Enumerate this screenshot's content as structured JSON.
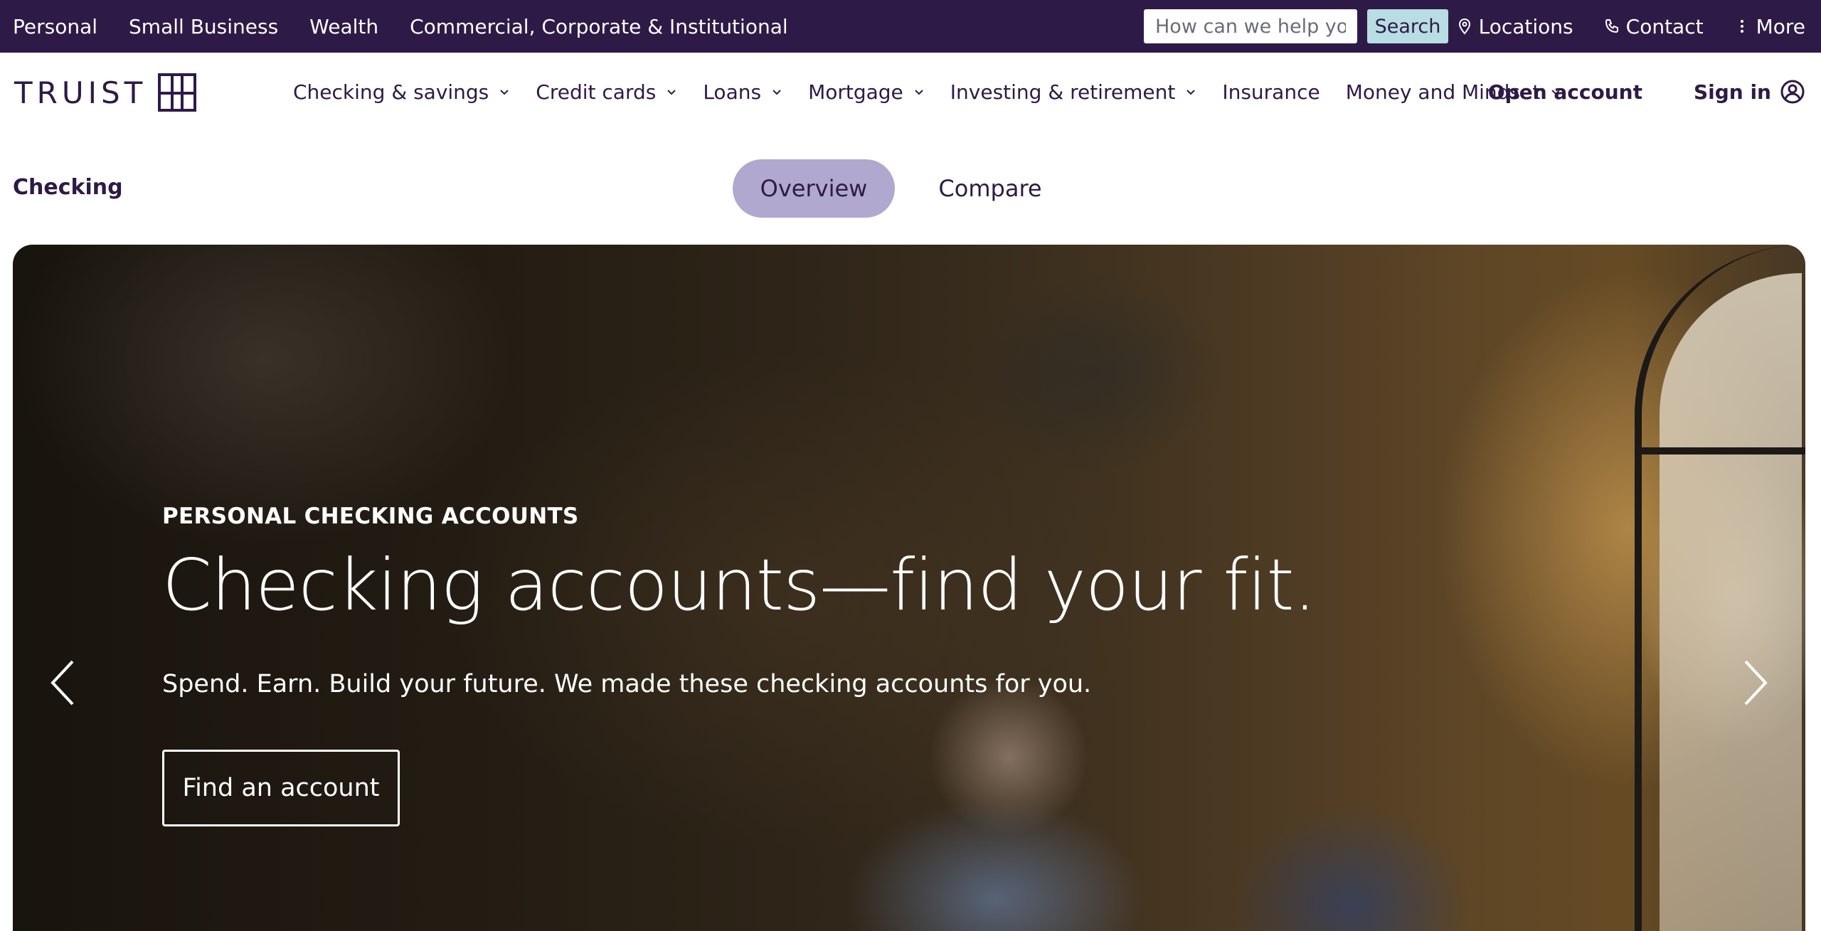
{
  "utility_bar": {
    "segments": [
      "Personal",
      "Small Business",
      "Wealth",
      "Commercial, Corporate & Institutional"
    ],
    "search": {
      "placeholder": "How can we help you?",
      "button_label": "Search"
    },
    "locations_label": "Locations",
    "contact_label": "Contact",
    "more_label": "More"
  },
  "main_nav": {
    "logo_text": "TRUIST",
    "items": [
      {
        "label": "Checking & savings",
        "has_dropdown": true
      },
      {
        "label": "Credit cards",
        "has_dropdown": true
      },
      {
        "label": "Loans",
        "has_dropdown": true
      },
      {
        "label": "Mortgage",
        "has_dropdown": true
      },
      {
        "label": "Investing & retirement",
        "has_dropdown": true
      },
      {
        "label": "Insurance",
        "has_dropdown": false
      },
      {
        "label": "Money and Mindset",
        "has_dropdown": true
      }
    ],
    "open_account_label": "Open account",
    "sign_in_label": "Sign in"
  },
  "sub_nav": {
    "section_title": "Checking",
    "tabs": [
      {
        "label": "Overview",
        "active": true
      },
      {
        "label": "Compare",
        "active": false
      }
    ]
  },
  "hero": {
    "eyebrow": "PERSONAL CHECKING ACCOUNTS",
    "title": "Checking accounts—find your fit.",
    "subtitle": "Spend. Earn. Build your future. We made these checking accounts for you.",
    "cta_label": "Find an account"
  },
  "colors": {
    "brand_purple": "#2e1a47",
    "search_button": "#b8dde3",
    "active_tab": "#b0a8cf"
  },
  "icons": [
    "truist-logo-icon",
    "location-pin-icon",
    "phone-icon",
    "more-vertical-icon",
    "chevron-down-icon",
    "user-circle-icon",
    "arrow-left-icon",
    "arrow-right-icon"
  ]
}
